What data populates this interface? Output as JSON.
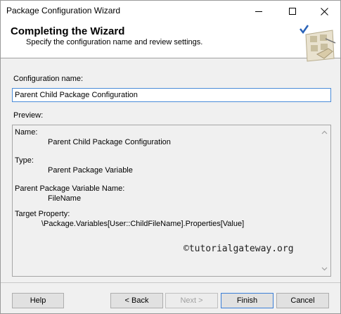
{
  "window": {
    "title": "Package Configuration Wizard"
  },
  "header": {
    "title": "Completing the Wizard",
    "subtitle": "Specify the configuration name and review settings."
  },
  "config": {
    "name_label": "Configuration name:",
    "name_value": "Parent Child Package Configuration"
  },
  "preview": {
    "label": "Preview:",
    "items": [
      {
        "key": "Name:",
        "value": "Parent Child Package Configuration"
      },
      {
        "key": "Type:",
        "value": "Parent Package Variable"
      },
      {
        "key": "Parent Package Variable Name:",
        "value": "FileName"
      },
      {
        "key": "Target Property:",
        "value": "\\Package.Variables[User::ChildFileName].Properties[Value]"
      }
    ],
    "watermark": "©tutorialgateway.org"
  },
  "buttons": {
    "help": "Help",
    "back": "< Back",
    "next": "Next >",
    "finish": "Finish",
    "cancel": "Cancel"
  },
  "icons": {
    "minimize": "minimize-icon",
    "maximize": "maximize-icon",
    "close": "close-icon",
    "wizard_art": "wizard-checkmark-icon"
  },
  "colors": {
    "accent": "#3c7fd6",
    "banner_bg": "#ffffff",
    "dialog_bg": "#f0f0f0"
  }
}
